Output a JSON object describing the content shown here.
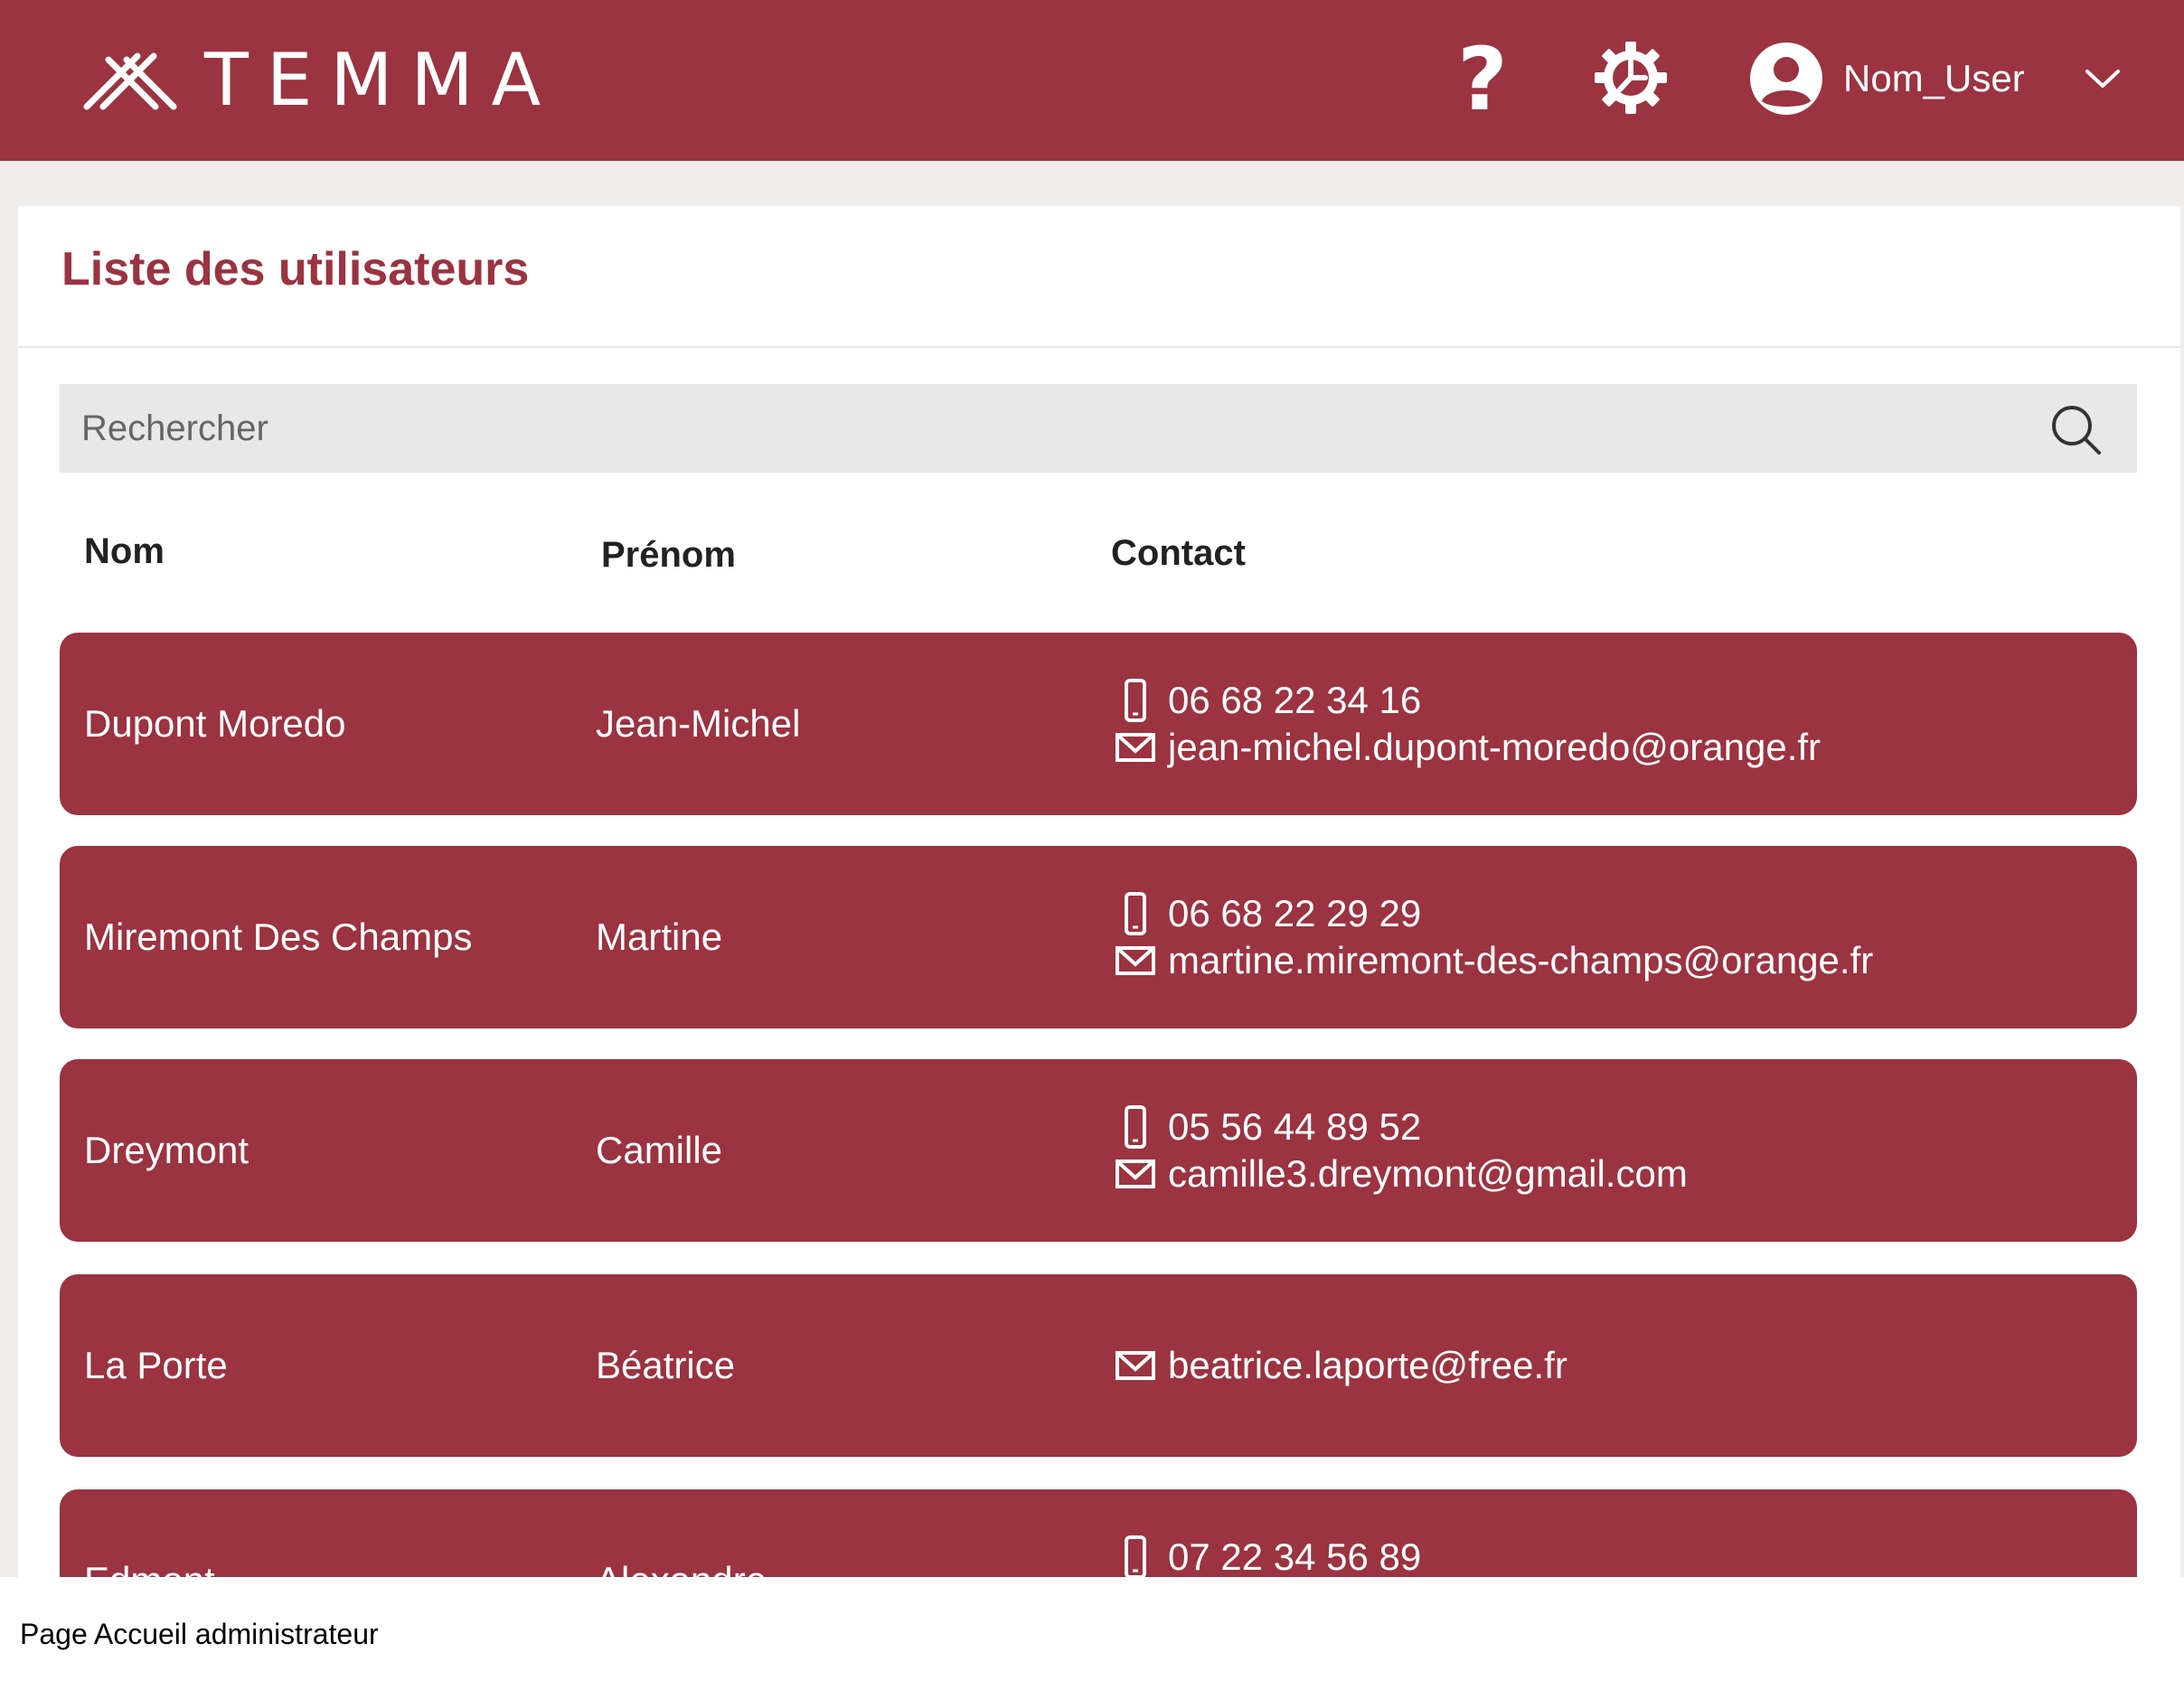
{
  "header": {
    "logo_text": "TEMMA",
    "help_label": "?",
    "user_name": "Nom_User",
    "brand_color": "#9b3341"
  },
  "page": {
    "title": "Liste des utilisateurs"
  },
  "search": {
    "placeholder": "Rechercher",
    "icon": "search-icon"
  },
  "table": {
    "headers": {
      "nom": "Nom",
      "prenom": "Prénom",
      "contact": "Contact"
    },
    "rows": [
      {
        "nom": "Dupont Moredo",
        "prenom": "Jean-Michel",
        "phone": "06 68 22 34 16",
        "email": "jean-michel.dupont-moredo@orange.fr"
      },
      {
        "nom": "Miremont Des Champs",
        "prenom": "Martine",
        "phone": "06 68 22 29 29",
        "email": "martine.miremont-des-champs@orange.fr"
      },
      {
        "nom": "Dreymont",
        "prenom": "Camille",
        "phone": "05 56 44 89 52",
        "email": "camille3.dreymont@gmail.com"
      },
      {
        "nom": "La Porte",
        "prenom": "Béatrice",
        "phone": "",
        "email": "beatrice.laporte@free.fr"
      },
      {
        "nom": "Edmont",
        "prenom": "Alexandre",
        "phone": "07 22 34 56 89",
        "email": ""
      }
    ]
  },
  "caption": "Page Accueil administrateur"
}
